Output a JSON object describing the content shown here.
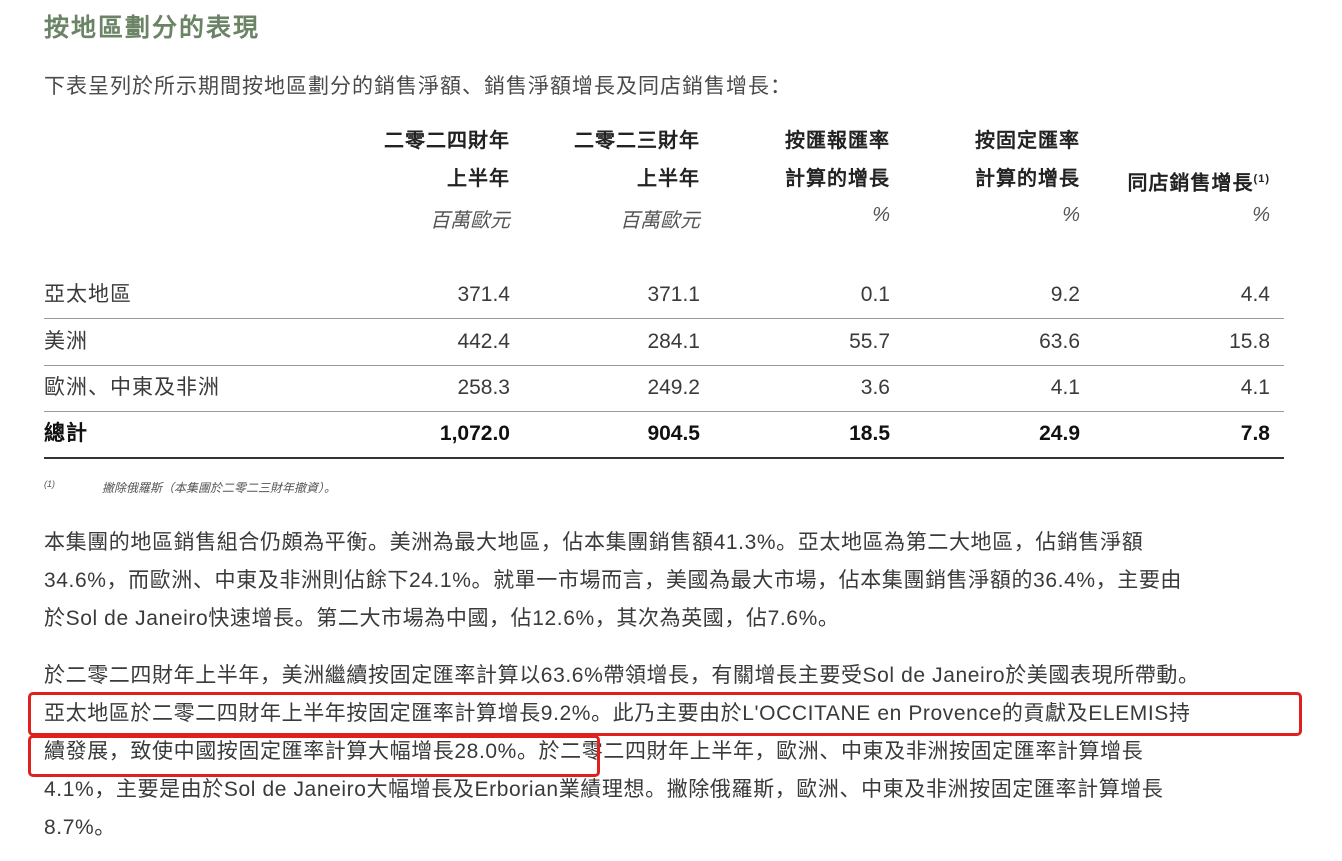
{
  "section_title": "按地區劃分的表現",
  "intro": "下表呈列於所示期間按地區劃分的銷售淨額、銷售淨額增長及同店銷售增長：",
  "table": {
    "columns": [
      {
        "line1": "二零二四財年",
        "line2": "上半年",
        "unit": "百萬歐元"
      },
      {
        "line1": "二零二三財年",
        "line2": "上半年",
        "unit": "百萬歐元"
      },
      {
        "line1": "按匯報匯率",
        "line2": "計算的增長",
        "unit": "%"
      },
      {
        "line1": "按固定匯率",
        "line2": "計算的增長",
        "unit": "%"
      },
      {
        "line1": "",
        "line2": "同店銷售增長",
        "sup": "(1)",
        "unit": "%"
      }
    ],
    "rows": [
      {
        "label": "亞太地區",
        "values": [
          "371.4",
          "371.1",
          "0.1",
          "9.2",
          "4.4"
        ]
      },
      {
        "label": "美洲",
        "values": [
          "442.4",
          "284.1",
          "55.7",
          "63.6",
          "15.8"
        ]
      },
      {
        "label": "歐洲、中東及非洲",
        "values": [
          "258.3",
          "249.2",
          "3.6",
          "4.1",
          "4.1"
        ]
      }
    ],
    "total": {
      "label": "總計",
      "values": [
        "1,072.0",
        "904.5",
        "18.5",
        "24.9",
        "7.8"
      ]
    }
  },
  "footnote": {
    "marker": "(1)",
    "text": "撇除俄羅斯（本集團於二零二三財年撤資）。"
  },
  "paragraph1": [
    "本集團的地區銷售組合仍頗為平衡。美洲為最大地區，佔本集團銷售額41.3%。亞太地區為第二大地區，佔銷售淨額",
    "34.6%，而歐洲、中東及非洲則佔餘下24.1%。就單一市場而言，美國為最大市場，佔本集團銷售淨額的36.4%，主要由",
    "於Sol de Janeiro快速增長。第二大市場為中國，佔12.6%，其次為英國，佔7.6%。"
  ],
  "paragraph2": [
    "於二零二四財年上半年，美洲繼續按固定匯率計算以63.6%帶領增長，有關增長主要受Sol de Janeiro於美國表現所帶動。",
    "亞太地區於二零二四財年上半年按固定匯率計算增長9.2%。此乃主要由於L'OCCITANE en Provence的貢獻及ELEMIS持",
    "續發展，致使中國按固定匯率計算大幅增長28.0%。於二零二四財年上半年，歐洲、中東及非洲按固定匯率計算增長",
    "4.1%，主要是由於Sol de Janeiro大幅增長及Erborian業績理想。撇除俄羅斯，歐洲、中東及非洲按固定匯率計算增長",
    "8.7%。"
  ]
}
